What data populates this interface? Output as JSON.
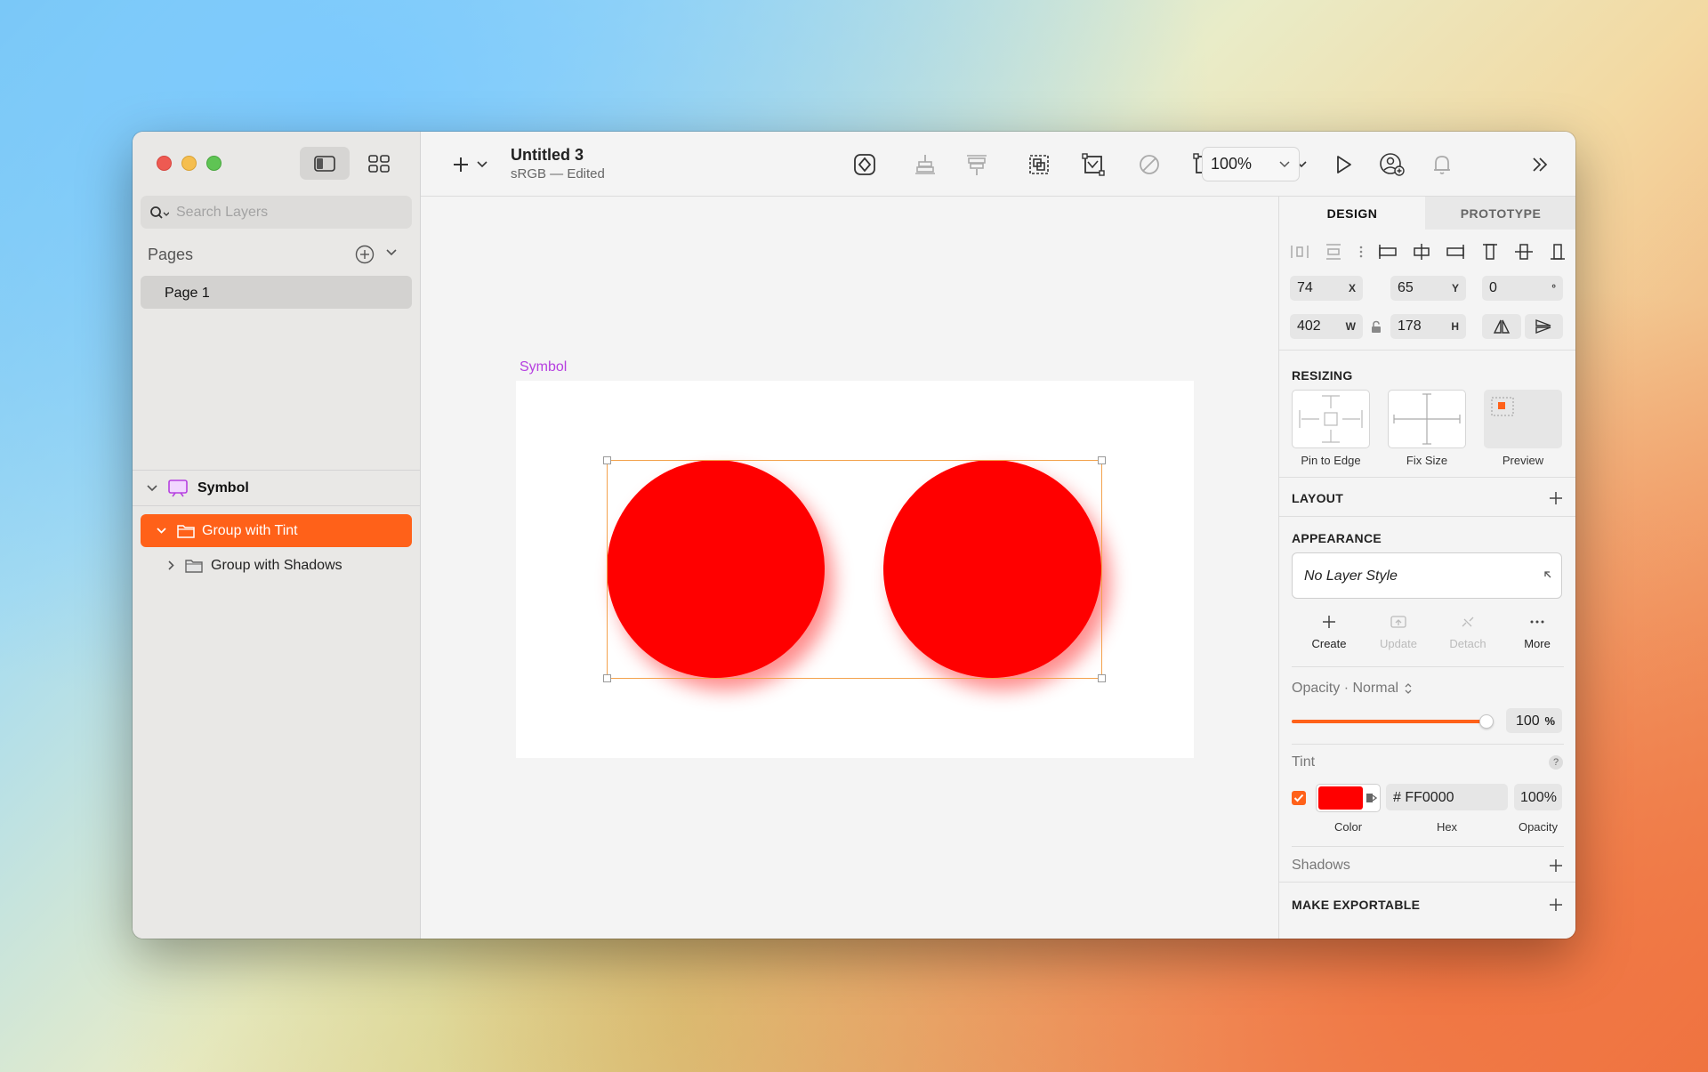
{
  "window": {
    "sidebar": {
      "search_placeholder": "Search Layers",
      "pages_header": "Pages",
      "pages": [
        {
          "label": "Page 1"
        }
      ],
      "layers": {
        "symbol": "Symbol",
        "items": [
          {
            "label": "Group with Tint",
            "selected": true
          },
          {
            "label": "Group with Shadows",
            "selected": false
          }
        ]
      }
    },
    "toolbar": {
      "doc_title": "Untitled 3",
      "doc_subtitle": "sRGB — Edited",
      "zoom": "100%"
    },
    "canvas": {
      "artboard_label": "Symbol",
      "shape_color": "#FF0000"
    },
    "inspector": {
      "tabs": {
        "design": "DESIGN",
        "prototype": "PROTOTYPE"
      },
      "x": "74",
      "x_suffix": "X",
      "y": "65",
      "y_suffix": "Y",
      "rotation": "0",
      "rotation_suffix": "°",
      "w": "402",
      "w_suffix": "W",
      "h": "178",
      "h_suffix": "H",
      "resizing": {
        "header": "RESIZING",
        "options": [
          "Pin to Edge",
          "Fix Size",
          "Preview"
        ]
      },
      "layout_header": "LAYOUT",
      "appearance": {
        "header": "APPEARANCE",
        "layer_style": "No Layer Style",
        "actions": {
          "create": "Create",
          "update": "Update",
          "detach": "Detach",
          "more": "More"
        },
        "opacity_label": "Opacity · Normal",
        "opacity_value": "100",
        "opacity_suffix": "%"
      },
      "tint": {
        "header": "Tint",
        "help": "?",
        "enabled": true,
        "color": "#FF0000",
        "hex": "# FF0000",
        "opacity": "100%",
        "labels": {
          "color": "Color",
          "hex": "Hex",
          "opacity": "Opacity"
        }
      },
      "shadows_header": "Shadows",
      "exportable_header": "MAKE EXPORTABLE"
    },
    "accent_color": "#FF6119"
  }
}
